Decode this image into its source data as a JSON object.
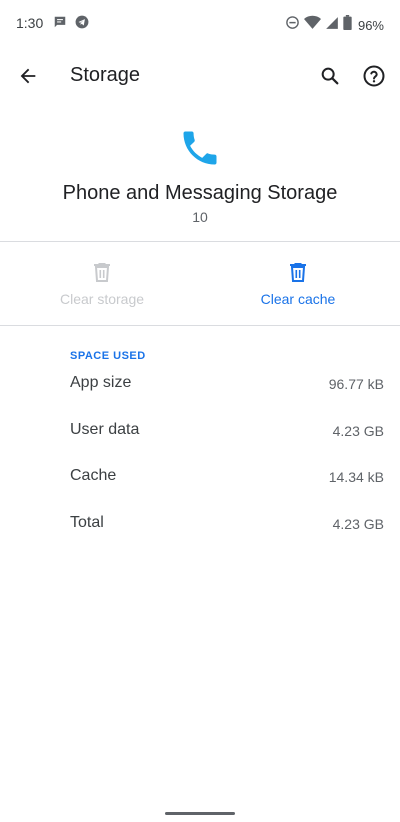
{
  "status_bar": {
    "time": "1:30",
    "battery_percent": "96%",
    "icons": [
      "message-icon",
      "telegram-icon",
      "dnd-icon",
      "wifi-icon",
      "signal-icon",
      "battery-icon"
    ]
  },
  "app_bar": {
    "title": "Storage"
  },
  "app_info": {
    "name": "Phone and Messaging Storage",
    "version": "10",
    "icon": "phone-icon",
    "icon_color": "#1ea5e9"
  },
  "actions": {
    "clear_storage": {
      "label": "Clear storage",
      "enabled": false
    },
    "clear_cache": {
      "label": "Clear cache",
      "enabled": true
    }
  },
  "space_used": {
    "header": "SPACE USED",
    "rows": [
      {
        "label": "App size",
        "value": "96.77 kB"
      },
      {
        "label": "User data",
        "value": "4.23 GB"
      },
      {
        "label": "Cache",
        "value": "14.34 kB"
      },
      {
        "label": "Total",
        "value": "4.23 GB"
      }
    ]
  },
  "colors": {
    "accent": "#1a73e8",
    "disabled": "#c8cacd"
  }
}
